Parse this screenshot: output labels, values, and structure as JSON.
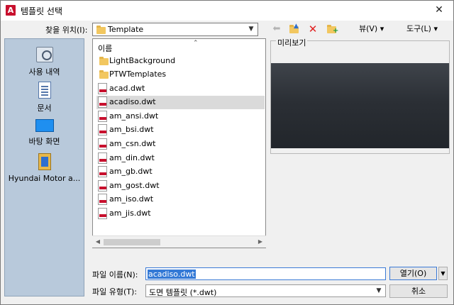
{
  "window": {
    "title": "템플릿 선택",
    "close_glyph": "✕"
  },
  "toolbar": {
    "lookin_label": "찾을 위치(I):",
    "lookin_value": "Template",
    "view_menu": "뷰(V)   ▾",
    "tools_menu": "도구(L)   ▾"
  },
  "places": [
    {
      "label": "사용 내역"
    },
    {
      "label": "문서"
    },
    {
      "label": "바탕 화면"
    },
    {
      "label": "Hyundai Motor a..."
    }
  ],
  "filelist": {
    "column_header": "이름",
    "items": [
      {
        "name": "LightBackground",
        "kind": "folder"
      },
      {
        "name": "PTWTemplates",
        "kind": "folder"
      },
      {
        "name": "acad.dwt",
        "kind": "dwt"
      },
      {
        "name": "acadiso.dwt",
        "kind": "dwt",
        "selected": true
      },
      {
        "name": "am_ansi.dwt",
        "kind": "dwt"
      },
      {
        "name": "am_bsi.dwt",
        "kind": "dwt"
      },
      {
        "name": "am_csn.dwt",
        "kind": "dwt"
      },
      {
        "name": "am_din.dwt",
        "kind": "dwt"
      },
      {
        "name": "am_gb.dwt",
        "kind": "dwt"
      },
      {
        "name": "am_gost.dwt",
        "kind": "dwt"
      },
      {
        "name": "am_iso.dwt",
        "kind": "dwt"
      },
      {
        "name": "am_jis.dwt",
        "kind": "dwt"
      }
    ]
  },
  "preview": {
    "label": "미리보기"
  },
  "bottom": {
    "filename_label": "파일 이름(N):",
    "filename_value": "acadiso.dwt",
    "filetype_label": "파일 유형(T):",
    "filetype_value": "도면 템플릿 (*.dwt)",
    "open_label": "열기(O)",
    "cancel_label": "취소"
  }
}
